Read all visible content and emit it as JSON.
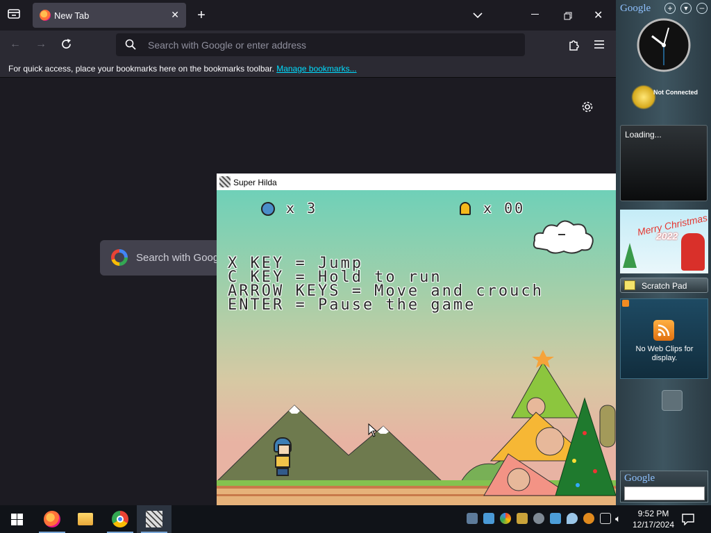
{
  "browser": {
    "tab_title": "New Tab",
    "search_placeholder": "Search with Google or enter address",
    "bookmarks_message": "For quick access, place your bookmarks here on the bookmarks toolbar.",
    "bookmarks_link": "Manage bookmarks...",
    "newtab_search_placeholder": "Search with Googl"
  },
  "game": {
    "window_title": "Super Hilda",
    "hud": {
      "lives_label": "x 3",
      "bells_label": "x 00"
    },
    "instructions": [
      "X KEY = Jump",
      "C KEY = Hold to run",
      "ARROW KEYS = Move and crouch",
      "ENTER = Pause the game"
    ]
  },
  "gadgets": {
    "header_brand": "Google",
    "weather_status": "Not Connected",
    "feed_status": "Loading...",
    "scratch_pad_label": "Scratch Pad",
    "web_clips_message": "No Web Clips for display.",
    "search_brand": "Google",
    "card_text": "Merry Christmas",
    "card_year": "2022"
  },
  "taskbar": {
    "time": "9:52 PM",
    "date": "12/17/2024"
  },
  "colors": {
    "firefox_bg": "#1c1b22",
    "link": "#00ddff",
    "taskbar": "#101318"
  }
}
